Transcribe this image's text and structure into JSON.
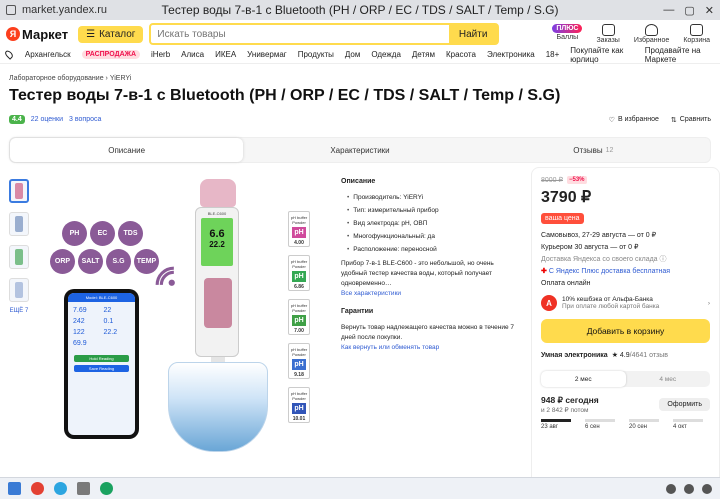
{
  "browser": {
    "url": "market.yandex.ru",
    "tab_title": "Тестер воды 7-в-1 с Bluetooth (PH / ORP / EC / TDS / SALT / Temp / S.G)"
  },
  "header": {
    "logo_text": "Маркет",
    "catalog_label": "Каталог",
    "search_placeholder": "Искать товары",
    "search_button": "Найти",
    "icons": [
      {
        "name": "plus-icon",
        "label": "Баллы",
        "badge": "ПЛЮС"
      },
      {
        "name": "orders-icon",
        "label": "Заказы"
      },
      {
        "name": "heart-icon",
        "label": "Избранное"
      },
      {
        "name": "cart-icon",
        "label": "Корзина"
      }
    ]
  },
  "nav": {
    "city": "Архангельск",
    "sale": "РАСПРОДАЖА",
    "items": [
      "iHerb",
      "Алиса",
      "ИКЕА",
      "Универмаг",
      "Продукты",
      "Дом",
      "Одежда",
      "Детям",
      "Красота",
      "Электроника",
      "18+"
    ],
    "right": [
      "Покупайте как юрлицо",
      "Продавайте на Маркете"
    ]
  },
  "breadcrumb": {
    "category": "Лабораторное оборудование",
    "brand": "YiERYi"
  },
  "product": {
    "title": "Тестер воды 7-в-1 с Bluetooth (PH / ORP / EC / TDS / SALT / Temp / S.G)",
    "rating": "4.4",
    "reviews": "22 оценки",
    "questions": "3 вопроса",
    "favorite": "В избранное",
    "compare": "Сравнить"
  },
  "tabs": [
    {
      "label": "Описание"
    },
    {
      "label": "Характеристики"
    },
    {
      "label": "Отзывы",
      "count": "12"
    }
  ],
  "gallery": {
    "more_label": "ЕЩЁ 7",
    "bubbles": [
      "PH",
      "EC",
      "TDS",
      "ORP",
      "SALT",
      "S.G",
      "TEMP"
    ],
    "device_label": "BLE-C600",
    "display_value": "6.6",
    "display_temp": "22.2",
    "app_header": "Model: BLE-C600",
    "app_values": [
      "7.69",
      "22",
      "242",
      "0.1",
      "122",
      "22.2",
      "69.9"
    ],
    "app_buttons": [
      "Hold Reading",
      "Save Reading"
    ],
    "buffers": [
      {
        "label": "pH buffer Powder",
        "value": "4.00",
        "color": "#d04a9c"
      },
      {
        "label": "pH buffer Powder",
        "value": "6.86",
        "color": "#34a853"
      },
      {
        "label": "pH buffer Powder",
        "value": "7.00",
        "color": "#3fa046"
      },
      {
        "label": "pH buffer Powder",
        "value": "9.18",
        "color": "#3b6fd0"
      },
      {
        "label": "pH buffer Powder",
        "value": "10.01",
        "color": "#3155b8"
      }
    ]
  },
  "description": {
    "heading": "Описание",
    "bullets": [
      "Производитель: YiERYi",
      "Тип: измерительный прибор",
      "Вид электрода: pH, ОВП",
      "Многофункциональный: да",
      "Расположение: переносной"
    ],
    "text": "Прибор 7-в-1 BLE-C600 - это небольшой, но очень удобный тестер качества воды, который получает одновременно…",
    "all_specs": "Все характеристики",
    "guarantee_heading": "Гарантии",
    "guarantee_text": "Вернуть товар надлежащего качества можно в течение 7 дней после покупки.",
    "return_link": "Как вернуть или обменять товар"
  },
  "buy": {
    "old_price": "8000 ₽",
    "discount": "−53%",
    "price": "3790 ₽",
    "your_price": "ваша цена",
    "pickup": "Самовывоз, 27-29 августа",
    "pickup_cost": "— от 0 ₽",
    "courier": "Курьером 30 августа",
    "courier_cost": "— от 0 ₽",
    "yandex_delivery": "Доставка Яндекса со своего склада",
    "plus_delivery": "С Яндекс Плюс доставка бесплатная",
    "pay_online": "Оплата онлайн",
    "cashback_title": "10% кешбэка от Альфа-Банка",
    "cashback_sub": "При оплате любой картой банка",
    "add_to_cart": "Добавить в корзину",
    "seller": "Умная электроника",
    "seller_rating": "★ 4.9",
    "seller_reviews": "/4641 отзыв",
    "split_tabs": [
      "2 мес",
      "4 мес"
    ],
    "split_price": "948 ₽ сегодня",
    "split_rest": "и 2 842 ₽ потом",
    "split_button": "Оформить",
    "split_dates": [
      "23 авг",
      "6 сен",
      "20 сен",
      "4 окт"
    ]
  },
  "colors": {
    "accent": "#ffdb4d",
    "link": "#2f5bd2",
    "sale": "#f0134d",
    "rating": "#4bb34b"
  }
}
